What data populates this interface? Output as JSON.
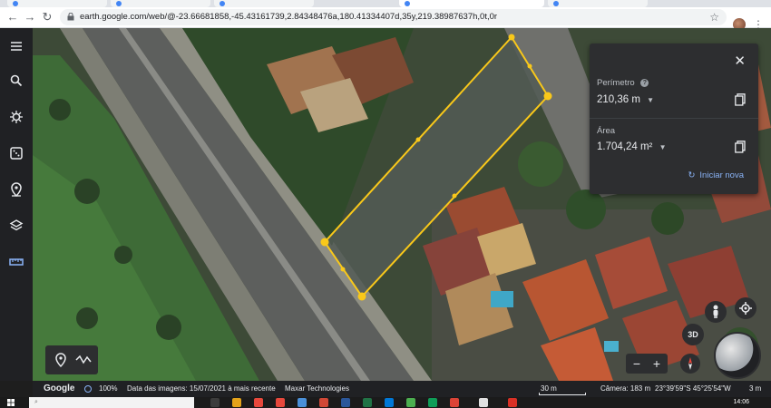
{
  "browser": {
    "url": "earth.google.com/web/@-23.66681858,-45.43161739,2.84348476a,180.41334407d,35y,219.38987637h,0t,0r",
    "accent": "#4285f4"
  },
  "rail": {
    "icons": [
      "menu-icon",
      "search-icon",
      "voyager-icon",
      "feeling-lucky-icon",
      "projects-icon",
      "map-style-icon",
      "measure-icon"
    ]
  },
  "panel": {
    "perimeter_label": "Perímetro",
    "perimeter_value": "210,36 m",
    "area_label": "Área",
    "area_value": "1.704,24 m²",
    "restart_label": "Iniciar nova",
    "link_color": "#8ab4f8"
  },
  "measurement": {
    "outline_color": "#f9c81a"
  },
  "controls": {
    "label_3d": "3D",
    "zoom_out": "−",
    "zoom_in": "+"
  },
  "status": {
    "brand": "Google",
    "loaded": "100%",
    "imagery_date": "Data das imagens: 15/07/2021 à mais recente",
    "provider": "Maxar Technologies",
    "scale": "30 m",
    "camera": "Câmera: 183 m",
    "coords": "23°39'59\"S 45°25'54\"W",
    "elevation": "3 m"
  },
  "taskbar": {
    "time": "14:06"
  }
}
